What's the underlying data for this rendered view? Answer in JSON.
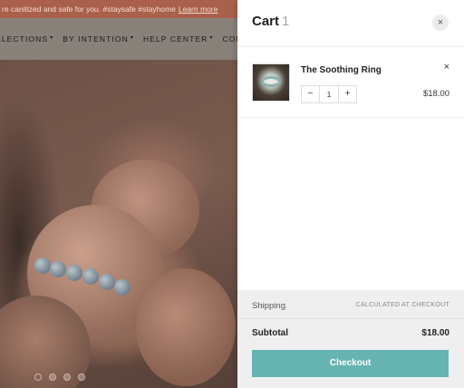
{
  "announcement": {
    "text": "re canitized and safe for you. #staysafe #stayhome",
    "link": "Learn more"
  },
  "nav": {
    "items": [
      {
        "label": "LLECTIONS",
        "has_caret": true
      },
      {
        "label": "BY INTENTION",
        "has_caret": true
      },
      {
        "label": "HELP CENTER",
        "has_caret": true
      },
      {
        "label": "COMM",
        "has_caret": false
      }
    ]
  },
  "slideshow": {
    "dot_count": 4,
    "active_index": 0
  },
  "cart": {
    "title": "Cart",
    "count": "1",
    "close_symbol": "×",
    "items": [
      {
        "name": "The Soothing Ring",
        "quantity": "1",
        "price": "$18.00",
        "remove_symbol": "×",
        "minus_symbol": "−",
        "plus_symbol": "+"
      }
    ],
    "shipping_label": "Shipping",
    "shipping_value": "CALCULATED AT CHECKOUT",
    "subtotal_label": "Subtotal",
    "subtotal_value": "$18.00",
    "checkout_label": "Checkout"
  },
  "colors": {
    "announcement_bg": "#a9614b",
    "checkout_button": "#66b4b2"
  }
}
